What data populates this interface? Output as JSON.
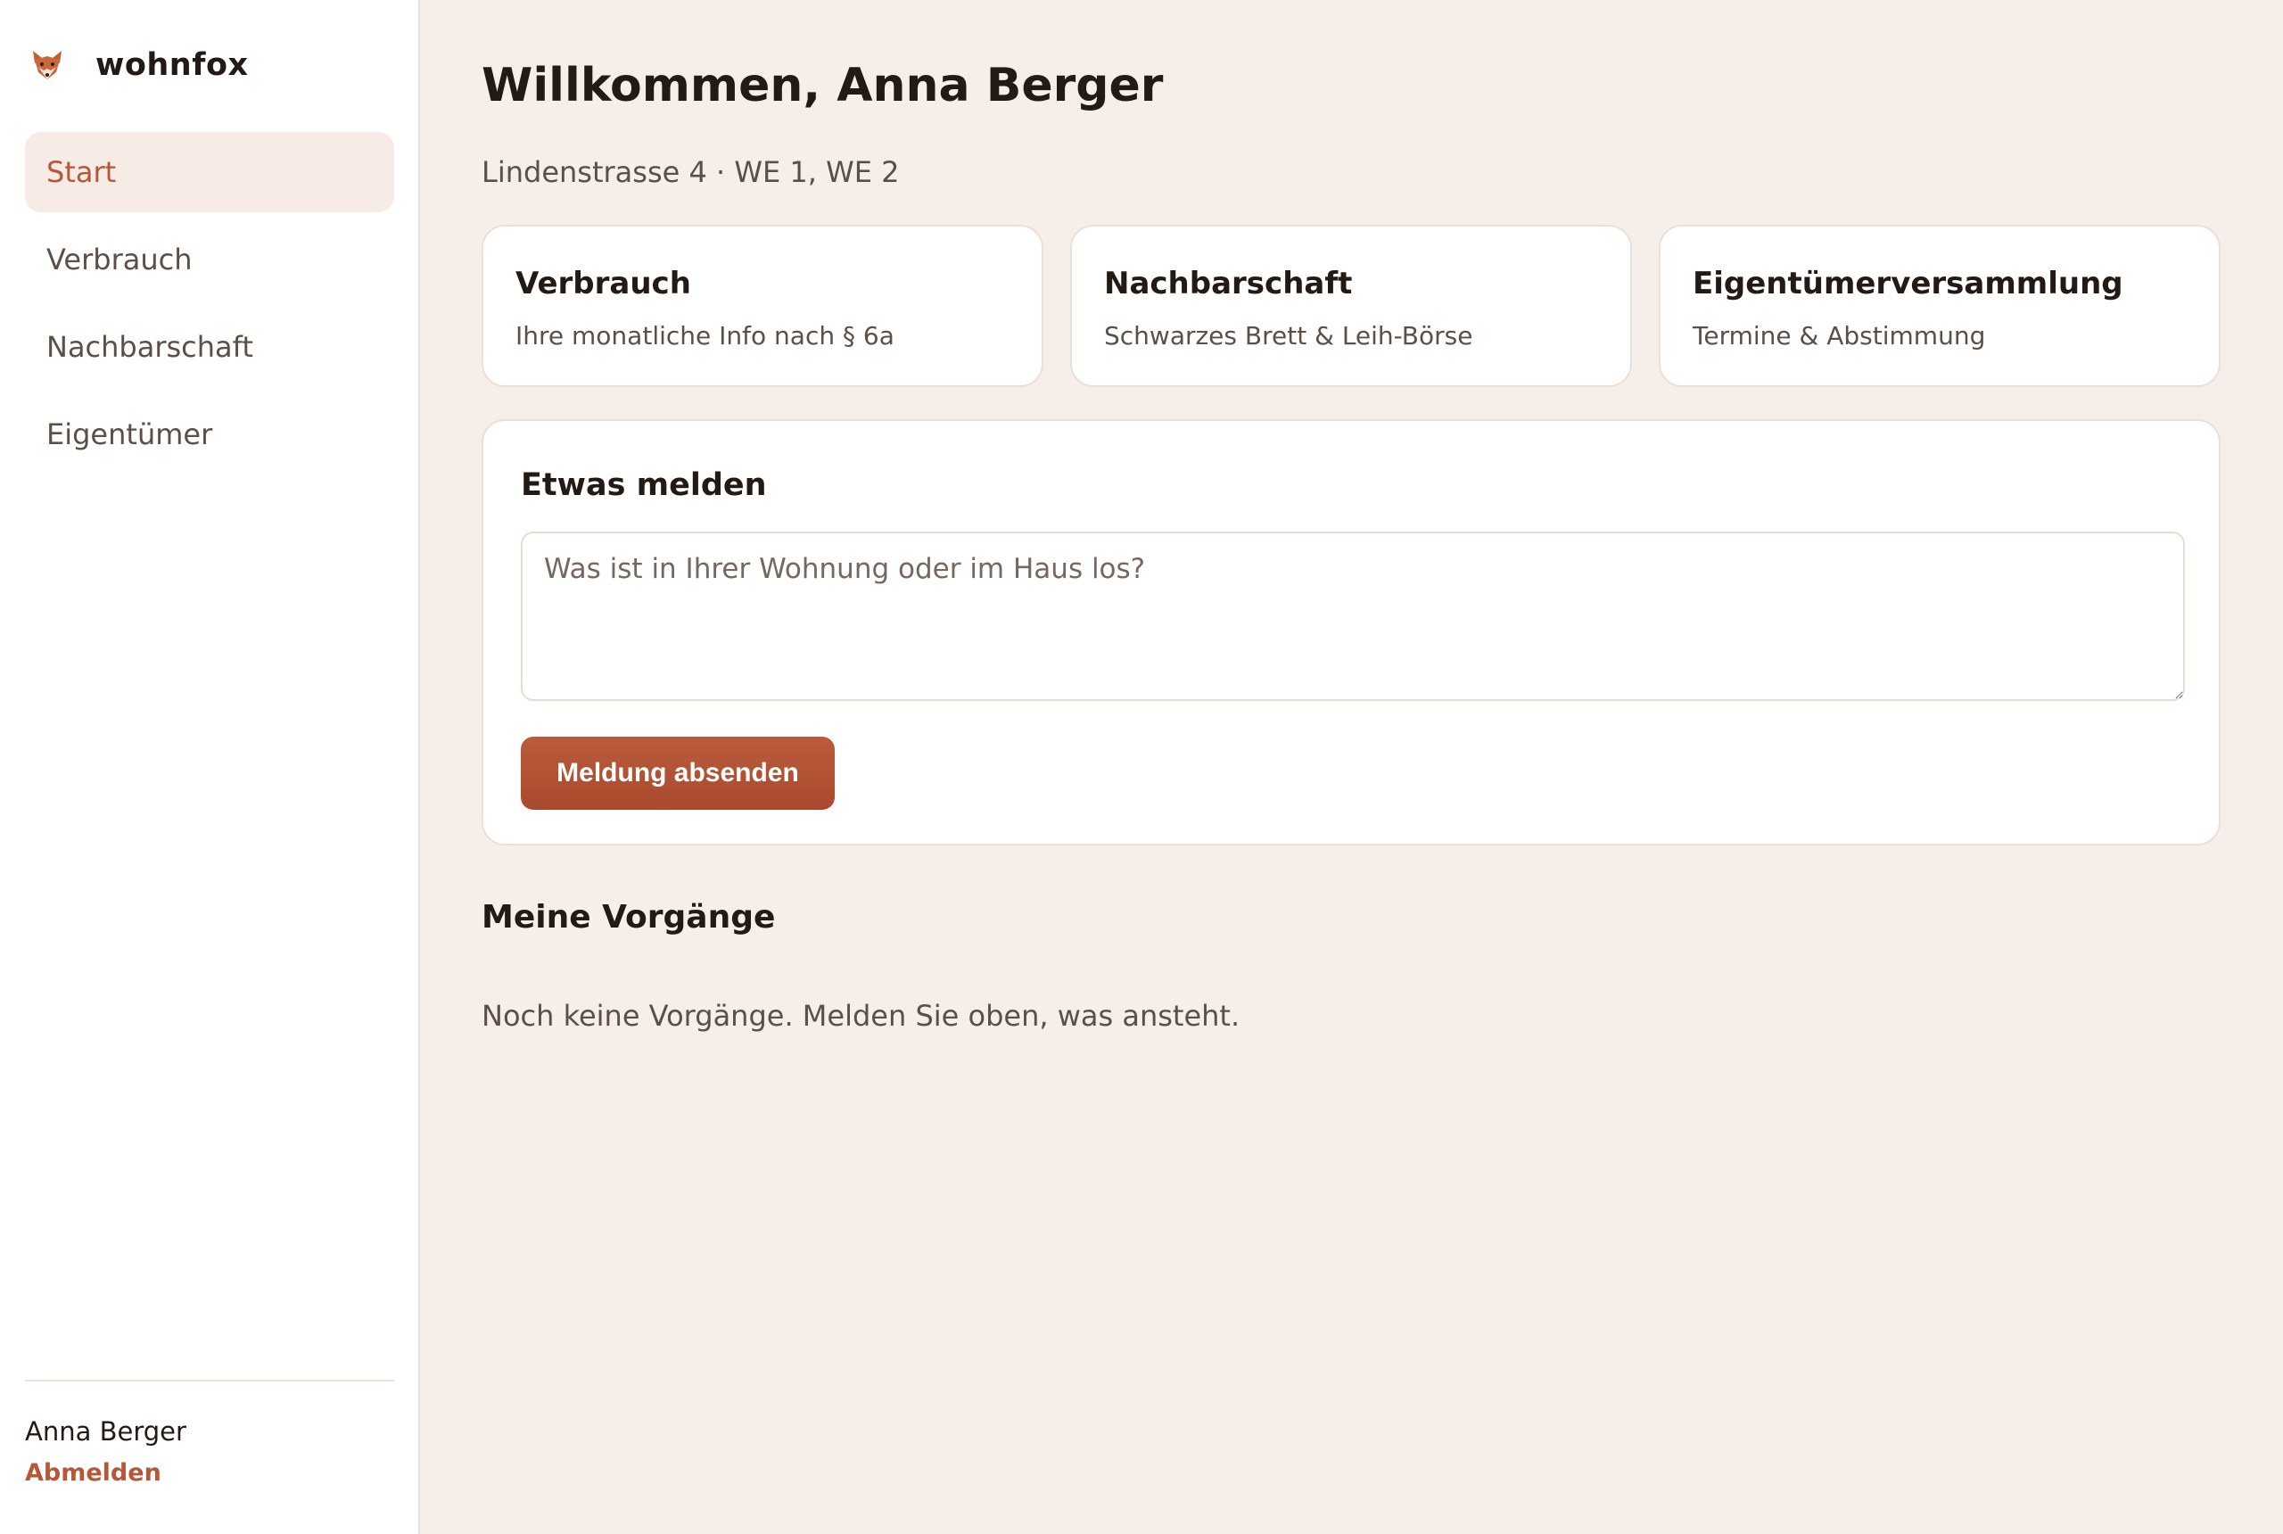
{
  "brand": {
    "name": "wohnfox",
    "icon": "fox-icon"
  },
  "nav": {
    "items": [
      {
        "label": "Start",
        "active": true
      },
      {
        "label": "Verbrauch",
        "active": false
      },
      {
        "label": "Nachbarschaft",
        "active": false
      },
      {
        "label": "Eigentümer",
        "active": false
      }
    ]
  },
  "user": {
    "name": "Anna Berger",
    "logout_label": "Abmelden"
  },
  "header": {
    "title": "Willkommen, Anna Berger",
    "subtitle": "Lindenstrasse 4 · WE 1, WE 2"
  },
  "cards": [
    {
      "title": "Verbrauch",
      "subtitle": "Ihre monatliche Info nach § 6a"
    },
    {
      "title": "Nachbarschaft",
      "subtitle": "Schwarzes Brett & Leih-Börse"
    },
    {
      "title": "Eigentümerversammlung",
      "subtitle": "Termine & Abstimmung"
    }
  ],
  "report": {
    "title": "Etwas melden",
    "placeholder": "Was ist in Ihrer Wohnung oder im Haus los?",
    "value": "",
    "submit_label": "Meldung absenden"
  },
  "cases": {
    "title": "Meine Vorgänge",
    "empty_text": "Noch keine Vorgänge. Melden Sie oben, was ansteht."
  },
  "colors": {
    "accent": "#b5583a",
    "background": "#f6efe9",
    "sidebar": "#ffffff",
    "active_nav_bg": "#f7ebe5",
    "text": "#231a15",
    "muted_text": "#5c4f48"
  }
}
